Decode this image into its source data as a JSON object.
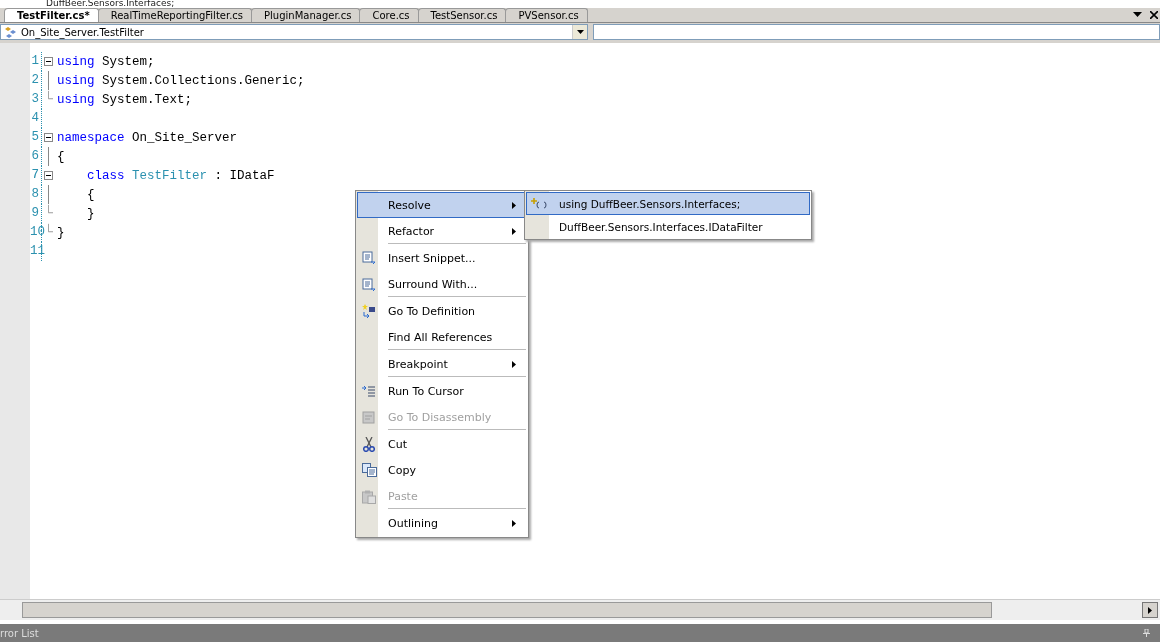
{
  "banner": "DuffBeer.Sensors.Interfaces;",
  "tabs": [
    {
      "label": "TestFilter.cs*",
      "selected": true
    },
    {
      "label": "RealTimeReportingFilter.cs",
      "selected": false
    },
    {
      "label": "PluginManager.cs",
      "selected": false
    },
    {
      "label": "Core.cs",
      "selected": false
    },
    {
      "label": "TestSensor.cs",
      "selected": false
    },
    {
      "label": "PVSensor.cs",
      "selected": false
    }
  ],
  "navbar": {
    "type_value": "On_Site_Server.TestFilter"
  },
  "code": [
    {
      "num": "1",
      "kind": "open",
      "tokens": [
        {
          "t": "using",
          "kind": "keyword"
        },
        {
          "t": "System;",
          "kind": "plain"
        }
      ]
    },
    {
      "num": "2",
      "kind": "bar",
      "tokens": [
        {
          "t": "using",
          "kind": "keyword"
        },
        {
          "t": "System.Collections.Generic;",
          "kind": "plain"
        }
      ]
    },
    {
      "num": "3",
      "kind": "end",
      "tokens": [
        {
          "t": "using",
          "kind": "keyword"
        },
        {
          "t": "System.Text;",
          "kind": "plain"
        }
      ]
    },
    {
      "num": "4",
      "kind": "none"
    },
    {
      "num": "5",
      "kind": "open",
      "tokens": [
        {
          "t": "namespace",
          "kind": "keyword"
        },
        {
          "t": "On_Site_Server",
          "kind": "plain"
        }
      ]
    },
    {
      "num": "6",
      "kind": "bar",
      "tokens": [
        {
          "t": "{",
          "kind": "plain"
        }
      ]
    },
    {
      "num": "7",
      "kind": "open",
      "tokens": [
        {
          "t": "    class",
          "kind": "keyword"
        },
        {
          "t": "TestFilter",
          "kind": "type"
        },
        {
          "t": ": IDataF",
          "kind": "plain"
        }
      ]
    },
    {
      "num": "8",
      "kind": "bar",
      "tokens": [
        {
          "t": "    {",
          "kind": "plain"
        }
      ]
    },
    {
      "num": "9",
      "kind": "end",
      "tokens": [
        {
          "t": "    }",
          "kind": "plain"
        }
      ]
    },
    {
      "num": "10",
      "kind": "end",
      "tokens": [
        {
          "t": "}",
          "kind": "plain"
        }
      ]
    },
    {
      "num": "11",
      "kind": "none"
    }
  ],
  "context_menu": [
    {
      "label": "Resolve",
      "submenu": true,
      "selected": true,
      "disabled": false,
      "separator_after": false
    },
    {
      "label": "Refactor",
      "submenu": true,
      "selected": false,
      "disabled": false,
      "separator_after": true
    },
    {
      "label": "Insert Snippet...",
      "submenu": false,
      "selected": false,
      "disabled": false,
      "separator_after": false
    },
    {
      "label": "Surround With...",
      "submenu": false,
      "selected": false,
      "disabled": false,
      "separator_after": true
    },
    {
      "label": "Go To Definition",
      "submenu": false,
      "selected": false,
      "disabled": false,
      "separator_after": false
    },
    {
      "label": "Find All References",
      "submenu": false,
      "selected": false,
      "disabled": false,
      "separator_after": true
    },
    {
      "label": "Breakpoint",
      "submenu": true,
      "selected": false,
      "disabled": false,
      "separator_after": true
    },
    {
      "label": "Run To Cursor",
      "submenu": false,
      "selected": false,
      "disabled": false,
      "separator_after": false
    },
    {
      "label": "Go To Disassembly",
      "submenu": false,
      "selected": false,
      "disabled": true,
      "separator_after": true
    },
    {
      "label": "Cut",
      "submenu": false,
      "selected": false,
      "disabled": false,
      "separator_after": false
    },
    {
      "label": "Copy",
      "submenu": false,
      "selected": false,
      "disabled": false,
      "separator_after": false
    },
    {
      "label": "Paste",
      "submenu": false,
      "selected": false,
      "disabled": true,
      "separator_after": true
    },
    {
      "label": "Outlining",
      "submenu": true,
      "selected": false,
      "disabled": false,
      "separator_after": false
    }
  ],
  "submenu": [
    {
      "label": "using DuffBeer.Sensors.Interfaces;",
      "selected": true
    },
    {
      "label": "DuffBeer.Sensors.Interfaces.IDataFilter",
      "selected": false
    }
  ],
  "bottom_panel": {
    "title": "rror List"
  }
}
